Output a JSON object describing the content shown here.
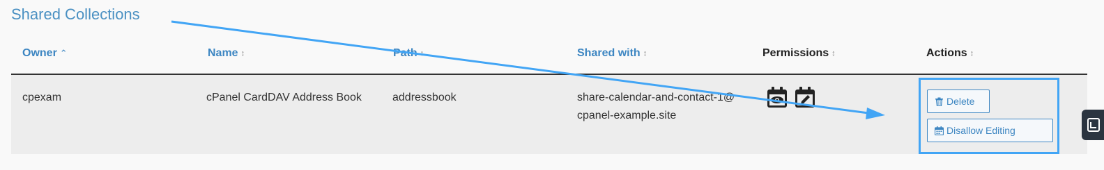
{
  "section": {
    "title": "Shared Collections"
  },
  "columns": [
    {
      "label": "Owner",
      "sort": "ascending"
    },
    {
      "label": "Name",
      "sort": "none"
    },
    {
      "label": "Path",
      "sort": "none"
    },
    {
      "label": "Shared with",
      "sort": "none"
    },
    {
      "label": "Permissions",
      "sort": "none"
    },
    {
      "label": "Actions",
      "sort": "none"
    }
  ],
  "rows": [
    {
      "owner": "cpexam",
      "name": "cPanel CardDAV Address Book",
      "path": "addressbook",
      "shared_with_line1": "share-calendar-and-contact-1@",
      "shared_with_line2": "cpanel-example.site",
      "permissions": [
        "calendar-view-icon",
        "calendar-edit-icon"
      ],
      "actions": {
        "delete_label": "Delete",
        "disallow_label": "Disallow Editing"
      }
    }
  ],
  "colors": {
    "accent": "#3d86c2",
    "annotation": "#42a5f5",
    "row_bg": "#ededed"
  }
}
